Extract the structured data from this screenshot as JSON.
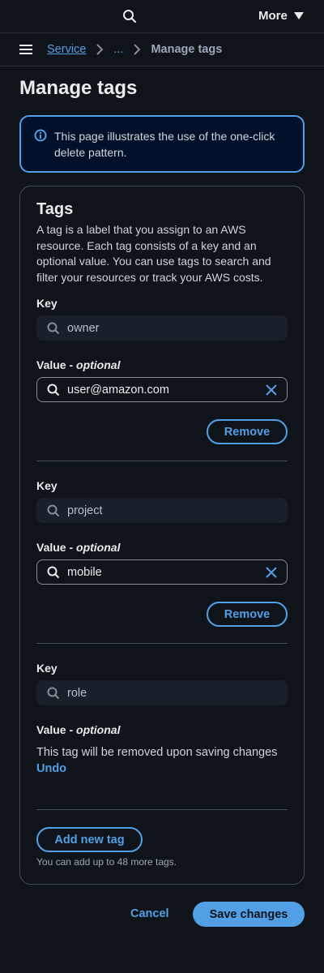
{
  "topbar": {
    "more_label": "More"
  },
  "breadcrumb": {
    "service": "Service",
    "ellipsis": "...",
    "current": "Manage tags"
  },
  "page": {
    "title": "Manage tags"
  },
  "alert": {
    "message": "This page illustrates the use of the one-click delete pattern."
  },
  "tags_panel": {
    "heading": "Tags",
    "description": "A tag is a label that you assign to an AWS resource. Each tag consists of a key and an optional value. You can use tags to search and filter your resources or track your AWS costs.",
    "key_label": "Key",
    "value_label": "Value - ",
    "value_optional": "optional",
    "remove_label": "Remove",
    "tags": [
      {
        "key": "owner",
        "value": "user@amazon.com"
      },
      {
        "key": "project",
        "value": "mobile"
      },
      {
        "key": "role",
        "removed_message": "This tag will be removed upon saving changes",
        "undo_label": "Undo"
      }
    ],
    "add_label": "Add new tag",
    "limit_hint": "You can add up to 48 more tags."
  },
  "footer": {
    "cancel_label": "Cancel",
    "save_label": "Save changes"
  },
  "colors": {
    "accent": "#539fe5",
    "background": "#0f141a",
    "alert_bg": "#001129"
  }
}
